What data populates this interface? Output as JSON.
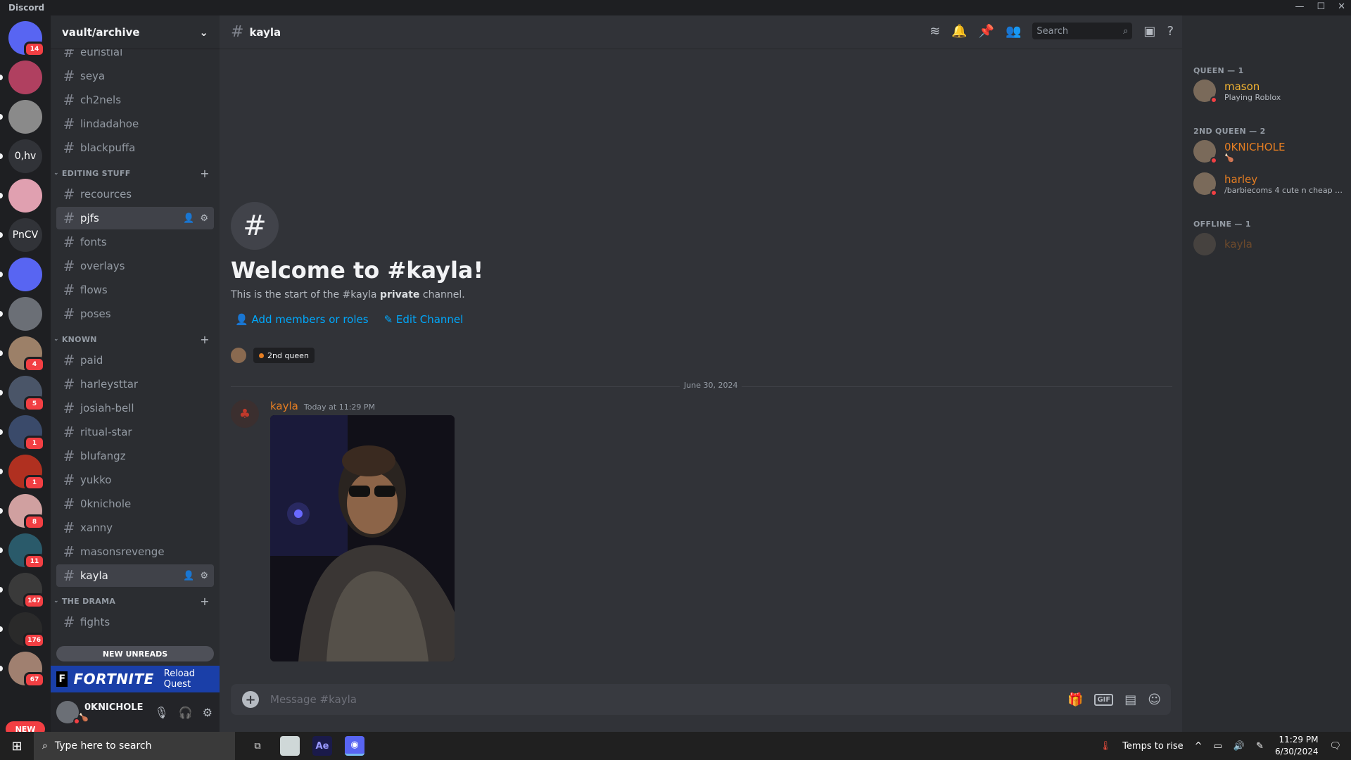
{
  "app": {
    "title": "Discord"
  },
  "servers": {
    "items": [
      {
        "label": "",
        "badge": "14",
        "color": "#5865f2"
      },
      {
        "label": "",
        "badge": "",
        "color": "#b04060"
      },
      {
        "label": "",
        "badge": "",
        "color": "#8a8a8a"
      },
      {
        "label": "0,hv",
        "badge": "",
        "color": "#313338"
      },
      {
        "label": "",
        "badge": "",
        "color": "#e0a0b0"
      },
      {
        "label": "PnCV",
        "badge": "",
        "color": "#313338"
      },
      {
        "label": "",
        "badge": "",
        "color": "#5865f2"
      },
      {
        "label": "",
        "badge": "",
        "color": "#6b6f76"
      },
      {
        "label": "",
        "badge": "4",
        "color": "#9c8068"
      },
      {
        "label": "",
        "badge": "5",
        "color": "#4a5568"
      },
      {
        "label": "",
        "badge": "1",
        "color": "#3a4a6a"
      },
      {
        "label": "",
        "badge": "1",
        "color": "#b03020"
      },
      {
        "label": "",
        "badge": "8",
        "color": "#d0a0a0"
      },
      {
        "label": "",
        "badge": "11",
        "color": "#2a5a6a"
      },
      {
        "label": "",
        "badge": "147",
        "color": "#3a3a3a"
      },
      {
        "label": "",
        "badge": "176",
        "color": "#2a2a2a"
      },
      {
        "label": "",
        "badge": "67",
        "color": "#a08070"
      }
    ],
    "new_label": "NEW"
  },
  "sidebar": {
    "server_name": "vault/archive",
    "channels_top": [
      "euristial",
      "seya",
      "ch2nels",
      "lindadahoe",
      "blackpuffa"
    ],
    "cat_editing": "EDITING STUFF",
    "channels_editing": [
      "recources",
      "pjfs",
      "fonts",
      "overlays",
      "flows",
      "poses"
    ],
    "cat_known": "KNOWN",
    "channels_known": [
      "paid",
      "harleysttar",
      "josiah-bell",
      "ritual-star",
      "blufangz",
      "yukko",
      "0knichole",
      "xanny",
      "masonsrevenge",
      "kayla"
    ],
    "cat_drama": "THE DRAMA",
    "channels_drama": [
      "fights"
    ],
    "new_unreads": "NEW UNREADS",
    "quest": {
      "brand": "FORTNITE",
      "action": "Reload Quest"
    },
    "user": {
      "name": "0KNICHOLE",
      "status": "🍗"
    }
  },
  "channel": {
    "name": "kayla",
    "search_placeholder": "Search",
    "welcome_title": "Welcome to #kayla!",
    "welcome_desc_prefix": "This is the start of the #kayla ",
    "welcome_desc_bold": "private",
    "welcome_desc_suffix": " channel.",
    "add_members": "Add members or roles",
    "edit_channel": "Edit Channel",
    "role_pill": "2nd queen",
    "date_divider": "June 30, 2024",
    "message": {
      "author": "kayla",
      "timestamp": "Today at 11:29 PM"
    },
    "composer_placeholder": "Message #kayla"
  },
  "members": {
    "groups": [
      {
        "label": "QUEEN — 1",
        "members": [
          {
            "name": "mason",
            "status": "Playing Roblox",
            "color": "#f0b232"
          }
        ]
      },
      {
        "label": "2ND QUEEN — 2",
        "members": [
          {
            "name": "0KNICHOLE",
            "status": "🍗",
            "color": "#e67e22"
          },
          {
            "name": "harley",
            "status": "/barbiecoms 4 cute n cheap e...",
            "color": "#e67e22"
          }
        ]
      },
      {
        "label": "OFFLINE — 1",
        "members": [
          {
            "name": "kayla",
            "status": "",
            "color": "#e67e22"
          }
        ]
      }
    ]
  },
  "taskbar": {
    "search_placeholder": "Type here to search",
    "weather": "Temps to rise",
    "time": "11:29 PM",
    "date": "6/30/2024"
  }
}
